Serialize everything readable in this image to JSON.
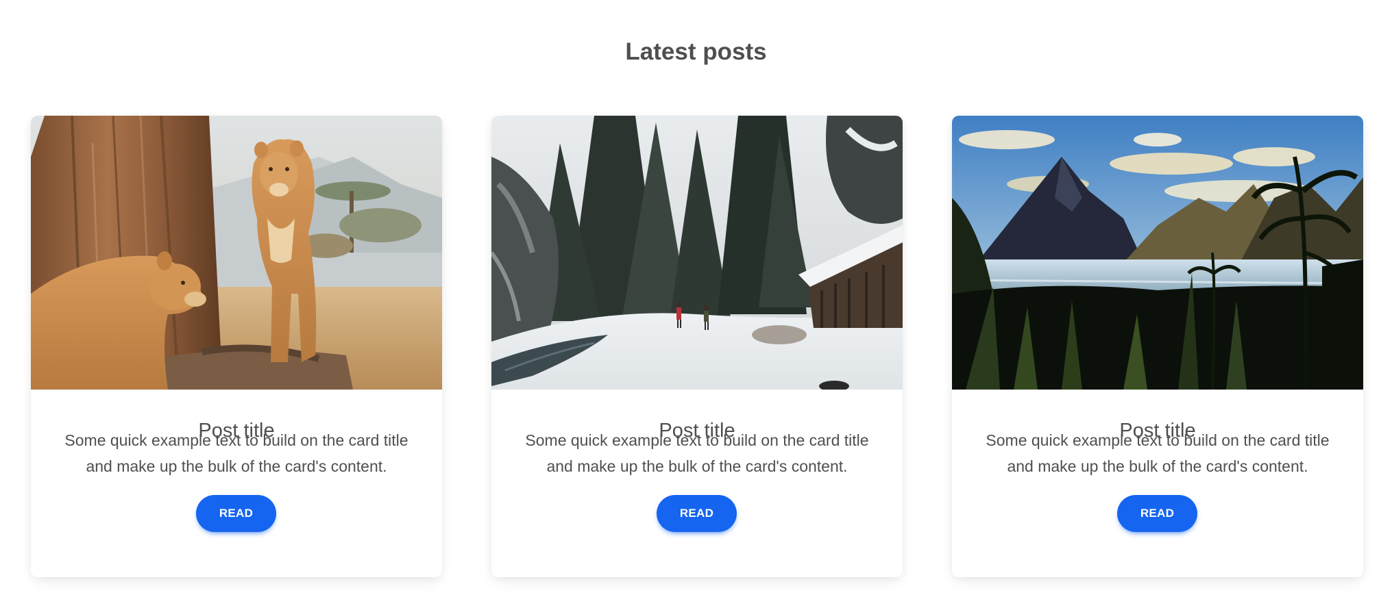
{
  "section": {
    "title": "Latest posts"
  },
  "cards": [
    {
      "image_alt": "Two lionesses beside a tree trunk in a savanna diorama",
      "title": "Post title",
      "text": "Some quick example text to build on the card title and make up the bulk of the card's content.",
      "button_label": "READ"
    },
    {
      "image_alt": "Two hikers in a snowy forest clearing beside a wooden cabin and a stream",
      "title": "Post title",
      "text": "Some quick example text to build on the card title and make up the bulk of the card's content.",
      "button_label": "READ"
    },
    {
      "image_alt": "Sharp mountain peaks over a lake with silhouetted tropical plants in the foreground",
      "title": "Post title",
      "text": "Some quick example text to build on the card title and make up the bulk of the card's content.",
      "button_label": "READ"
    }
  ],
  "colors": {
    "accent": "#1565f0",
    "text": "#4f4f4f",
    "background": "#ffffff"
  }
}
